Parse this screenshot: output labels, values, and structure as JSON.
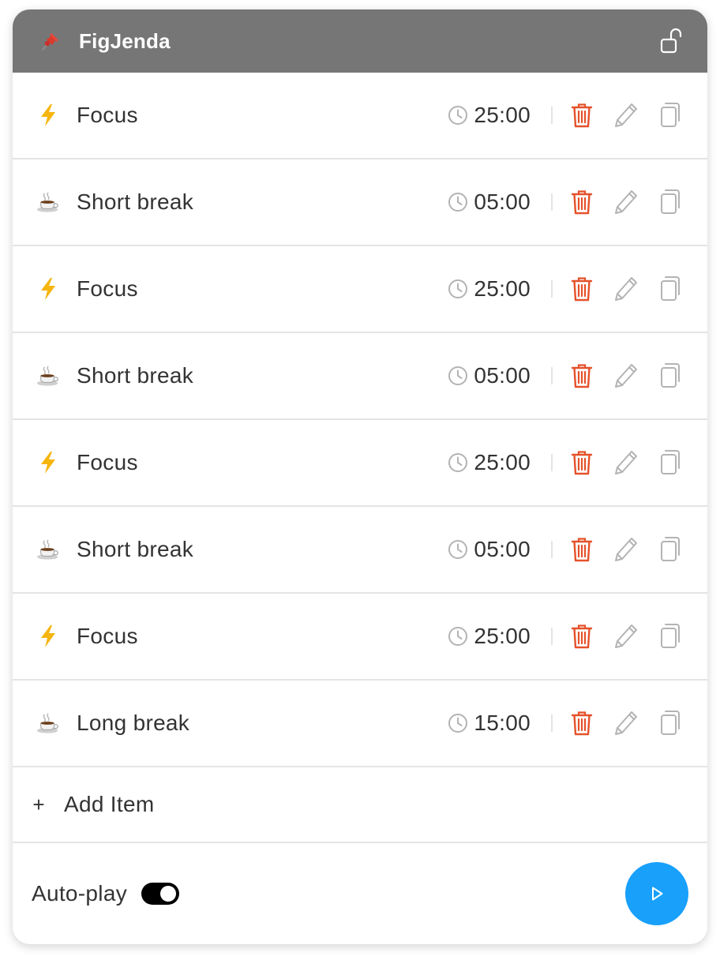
{
  "header": {
    "title": "FigJenda",
    "pin_icon": "pushpin-icon",
    "lock_icon": "unlock-icon",
    "background": "#767676"
  },
  "items": [
    {
      "icon": "lightning-icon",
      "label": "Focus",
      "time": "25:00"
    },
    {
      "icon": "coffee-icon",
      "label": "Short break",
      "time": "05:00"
    },
    {
      "icon": "lightning-icon",
      "label": "Focus",
      "time": "25:00"
    },
    {
      "icon": "coffee-icon",
      "label": "Short break",
      "time": "05:00"
    },
    {
      "icon": "lightning-icon",
      "label": "Focus",
      "time": "25:00"
    },
    {
      "icon": "coffee-icon",
      "label": "Short break",
      "time": "05:00"
    },
    {
      "icon": "lightning-icon",
      "label": "Focus",
      "time": "25:00"
    },
    {
      "icon": "coffee-icon",
      "label": "Long break",
      "time": "15:00"
    }
  ],
  "actions": {
    "delete_icon": "trash-icon",
    "edit_icon": "pencil-icon",
    "duplicate_icon": "copy-icon",
    "delete_color": "#e5512a",
    "muted_color": "#b3b3b3"
  },
  "add_item": {
    "plus": "+",
    "label": "Add Item"
  },
  "footer": {
    "autoplay_label": "Auto-play",
    "autoplay_on": true,
    "play_icon": "play-icon",
    "play_color": "#18a0fb"
  }
}
